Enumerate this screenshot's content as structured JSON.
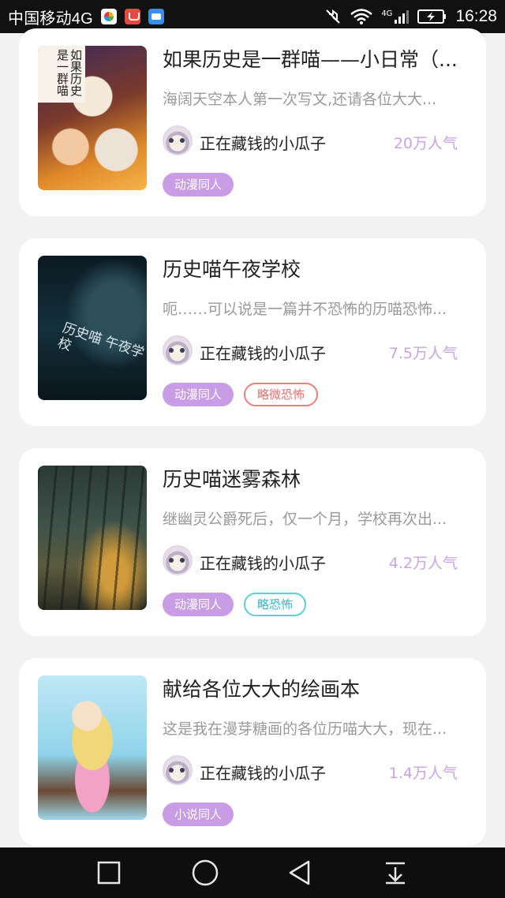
{
  "status_bar": {
    "carrier": "中国移动4G",
    "network_badge": "4G",
    "time": "16:28",
    "icons": [
      "app-icon-browser",
      "app-icon-shop",
      "app-icon-gallery",
      "mute-icon",
      "wifi-icon",
      "signal-icon",
      "battery-charging-icon"
    ]
  },
  "cards": [
    {
      "title": "如果历史是一群喵——小日常（...",
      "description": "海阔天空本人第一次写文,还请各位大大...",
      "author": "正在藏钱的小瓜子",
      "popularity": "20万人气",
      "tags": [
        {
          "label": "动漫同人",
          "style": "filled"
        }
      ],
      "cover_text": "如果历史是一群喵"
    },
    {
      "title": "历史喵午夜学校",
      "description": "呃……可以说是一篇并不恐怖的历喵恐怖...",
      "author": "正在藏钱的小瓜子",
      "popularity": "7.5万人气",
      "tags": [
        {
          "label": "动漫同人",
          "style": "filled"
        },
        {
          "label": "略微恐怖",
          "style": "outline-red"
        }
      ],
      "cover_text": "历史喵 午夜学校"
    },
    {
      "title": "历史喵迷雾森林",
      "description": "继幽灵公爵死后，仅一个月，学校再次出...",
      "author": "正在藏钱的小瓜子",
      "popularity": "4.2万人气",
      "tags": [
        {
          "label": "动漫同人",
          "style": "filled"
        },
        {
          "label": "略恐怖",
          "style": "outline-cyan"
        }
      ]
    },
    {
      "title": "献给各位大大的绘画本",
      "description": "这是我在漫芽糖画的各位历喵大大，现在...",
      "author": "正在藏钱的小瓜子",
      "popularity": "1.4万人气",
      "tags": [
        {
          "label": "小说同人",
          "style": "filled"
        }
      ]
    }
  ],
  "nav_bar": {
    "buttons": [
      "recent-apps-icon",
      "home-icon",
      "back-icon",
      "notification-pull-icon"
    ]
  },
  "colors": {
    "accent": "#c99de6",
    "popularity": "#c9a2e8",
    "tag_red": "#ea6b6b",
    "tag_cyan": "#2fb9c9"
  }
}
